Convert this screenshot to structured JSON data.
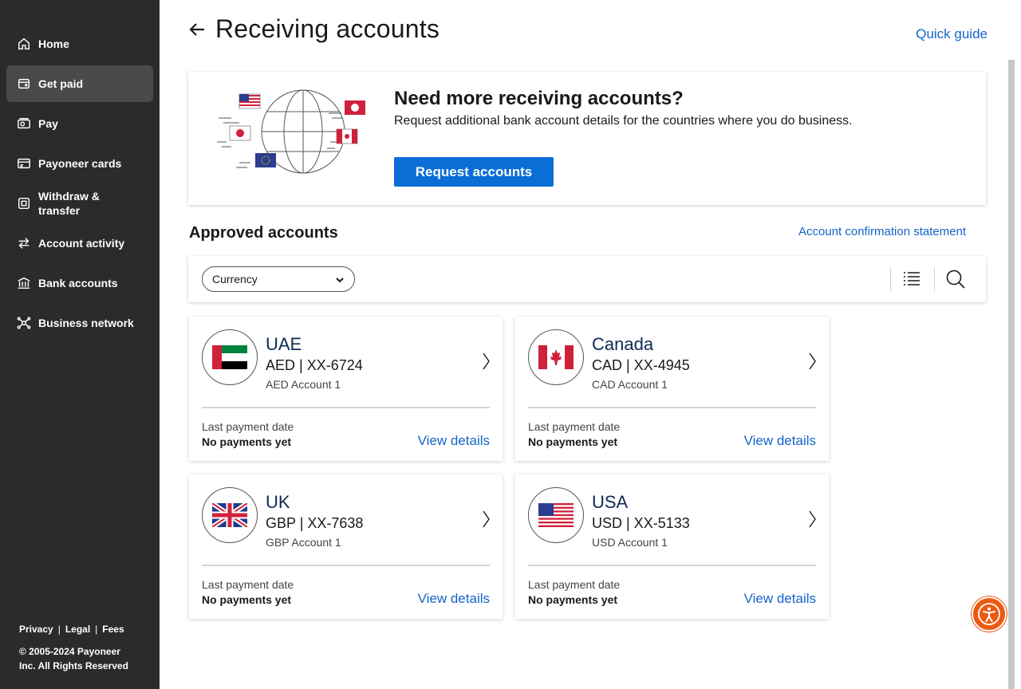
{
  "sidebar": {
    "items": [
      {
        "label": "Home",
        "icon": "home-icon"
      },
      {
        "label": "Get paid",
        "icon": "wallet-icon",
        "active": true
      },
      {
        "label": "Pay",
        "icon": "pay-icon"
      },
      {
        "label": "Payoneer cards",
        "icon": "card-icon"
      },
      {
        "label": "Withdraw & transfer",
        "icon": "withdraw-icon"
      },
      {
        "label": "Account activity",
        "icon": "transfer-arrows-icon"
      },
      {
        "label": "Bank accounts",
        "icon": "bank-icon"
      },
      {
        "label": "Business network",
        "icon": "network-icon"
      }
    ],
    "footer": {
      "privacy": "Privacy",
      "legal": "Legal",
      "fees": "Fees",
      "sep": "|",
      "copyright_line1": "© 2005-2024 Payoneer",
      "copyright_line2": "Inc. All Rights Reserved"
    }
  },
  "header": {
    "title": "Receiving accounts",
    "quick_guide": "Quick guide"
  },
  "promo": {
    "title": "Need more receiving accounts?",
    "subtitle": "Request additional bank account details for the countries where you do business.",
    "button": "Request accounts"
  },
  "approved": {
    "title": "Approved accounts",
    "confirmation_link": "Account confirmation statement",
    "filter_label": "Currency"
  },
  "accounts": [
    {
      "country": "UAE",
      "code": "AED | XX-6724",
      "name": "AED Account 1",
      "flag": "uae-flag-icon",
      "last_payment_label": "Last payment date",
      "last_payment": "No payments yet",
      "view": "View details"
    },
    {
      "country": "Canada",
      "code": "CAD | XX-4945",
      "name": "CAD Account 1",
      "flag": "canada-flag-icon",
      "last_payment_label": "Last payment date",
      "last_payment": "No payments yet",
      "view": "View details"
    },
    {
      "country": "UK",
      "code": "GBP | XX-7638",
      "name": "GBP Account 1",
      "flag": "uk-flag-icon",
      "last_payment_label": "Last payment date",
      "last_payment": "No payments yet",
      "view": "View details"
    },
    {
      "country": "USA",
      "code": "USD | XX-5133",
      "name": "USD Account 1",
      "flag": "usa-flag-icon",
      "last_payment_label": "Last payment date",
      "last_payment": "No payments yet",
      "view": "View details"
    }
  ],
  "colors": {
    "sidebar_bg": "#2b2b2b",
    "link": "#1464c8",
    "primary_button": "#0a6ed6",
    "accessibility_button": "#ec5a12"
  }
}
